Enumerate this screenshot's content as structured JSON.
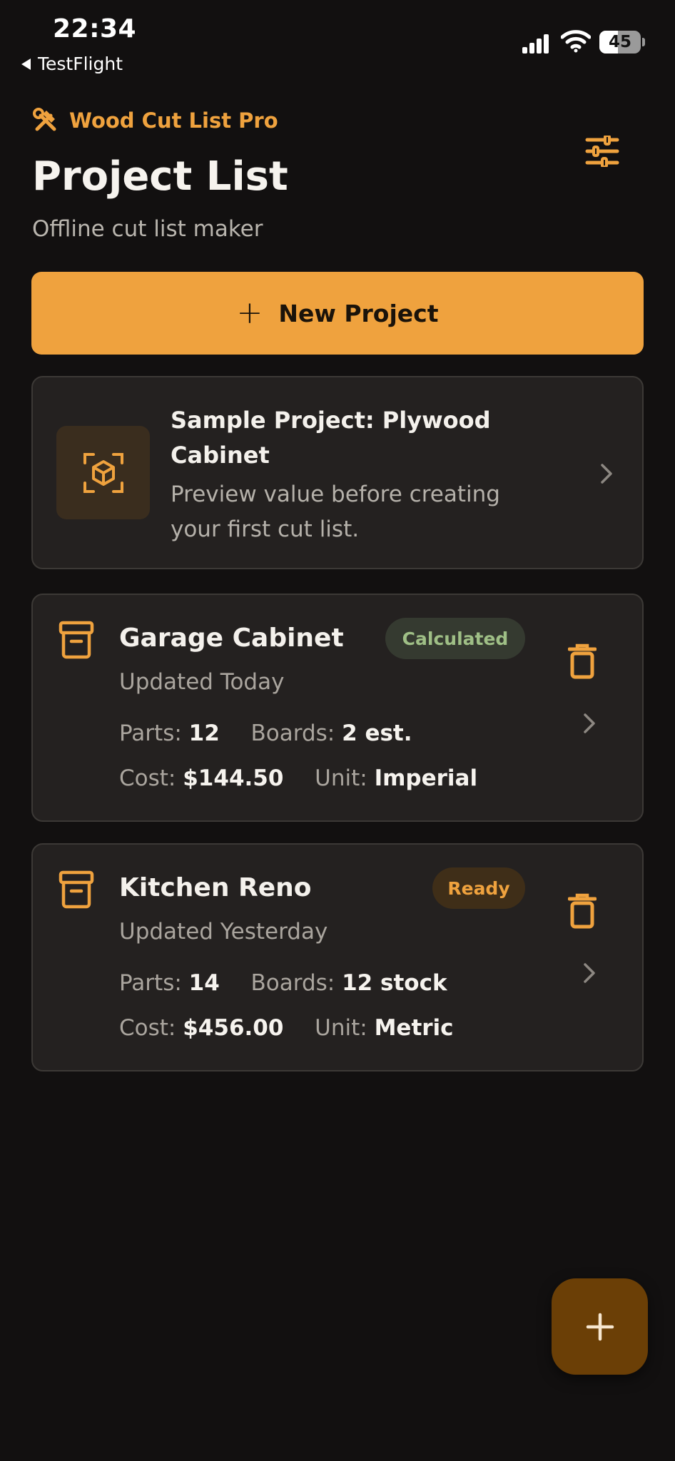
{
  "status_bar": {
    "time": "22:34",
    "back_app": "TestFlight",
    "battery_level": "45",
    "battery_fraction": 0.45
  },
  "header": {
    "brand_icon": "hammer-wrench-icon",
    "brand_name": "Wood Cut List Pro",
    "title": "Project List",
    "subtitle": "Offline cut list maker",
    "settings_icon": "sliders-icon"
  },
  "new_project": {
    "icon": "plus-icon",
    "label": "New Project"
  },
  "sample": {
    "icon": "cube-scan-icon",
    "title": "Sample Project: Plywood Cabinet",
    "description": "Preview value before creating your first cut list."
  },
  "labels": {
    "parts": "Parts:",
    "boards": "Boards:",
    "cost": "Cost:",
    "unit": "Unit:"
  },
  "projects": [
    {
      "name": "Garage Cabinet",
      "status": "Calculated",
      "updated": "Updated Today",
      "parts": "12",
      "boards": "2 est.",
      "cost": "$144.50",
      "unit": "Imperial"
    },
    {
      "name": "Kitchen Reno",
      "status": "Ready",
      "updated": "Updated Yesterday",
      "parts": "14",
      "boards": "12 stock",
      "cost": "$456.00",
      "unit": "Metric"
    }
  ],
  "fab": {
    "icon": "plus-icon"
  },
  "colors": {
    "accent": "#efa23e",
    "background": "#121010",
    "card": "#242120",
    "badge_calculated_bg": "#353a30",
    "badge_calculated_text": "#9fbf86",
    "badge_ready_bg": "#3f2e18",
    "badge_ready_text": "#efa23e",
    "fab_bg": "#6b3f06"
  }
}
